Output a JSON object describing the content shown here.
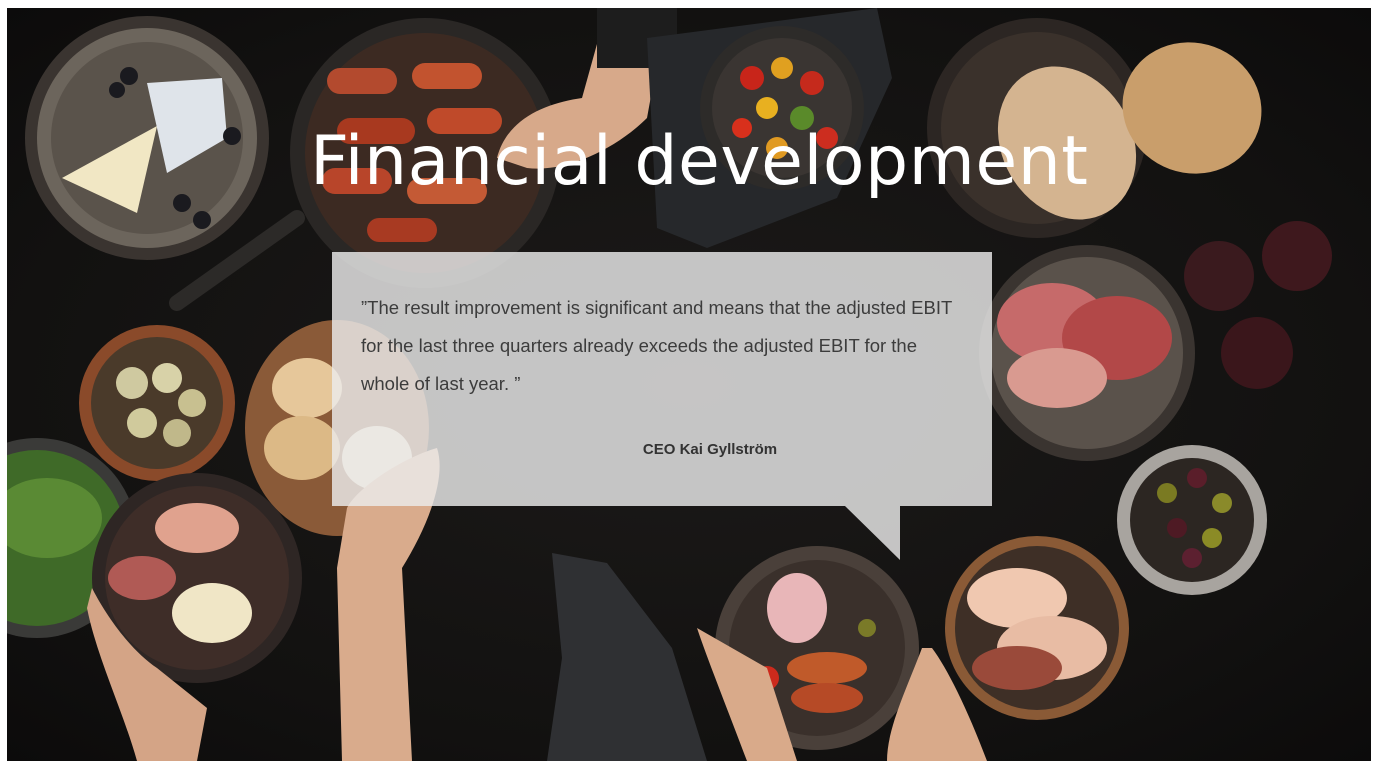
{
  "slide": {
    "title": "Financial development",
    "quote": "”The result improvement is significant and means that the adjusted EBIT for the last three quarters already exceeds the adjusted EBIT for the whole of last year. ”",
    "author": "CEO Kai Gyllström",
    "background_color": "#121110",
    "bubble_color": "#ececec"
  }
}
